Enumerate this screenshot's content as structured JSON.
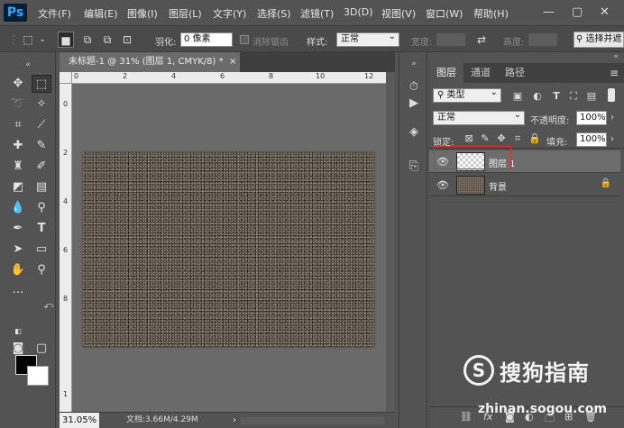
{
  "app": {
    "logo": "Ps"
  },
  "menu": [
    "文件(F)",
    "编辑(E)",
    "图像(I)",
    "图层(L)",
    "文字(Y)",
    "选择(S)",
    "滤镜(T)",
    "3D(D)",
    "视图(V)",
    "窗口(W)",
    "帮助(H)"
  ],
  "window_controls": [
    "—",
    "▢",
    "✕"
  ],
  "options": {
    "feather_label": "羽化:",
    "feather_value": "0 像素",
    "antialias_label": "消除锯齿",
    "style_label": "样式:",
    "style_value": "正常",
    "width_label": "宽度:",
    "height_label": "高度:",
    "select_mask_label": "选择并遮"
  },
  "document": {
    "tab_title": "未标题-1 @ 31% (图层 1, CMYK/8) *",
    "tab_close": "×",
    "hruler_labels": [
      "0",
      "2",
      "4",
      "6",
      "8",
      "10",
      "12"
    ],
    "vruler_labels": [
      "0",
      "2",
      "4",
      "6",
      "8",
      "1"
    ]
  },
  "status": {
    "zoom": "31.05%",
    "doc_info": "文档:3.66M/4.29M",
    "arrow": "›"
  },
  "layers_panel": {
    "tabs": [
      "图层",
      "通道",
      "路径"
    ],
    "active_tab": "图层",
    "filter_kind": "类型",
    "blend_mode": "正常",
    "opacity_label": "不透明度:",
    "opacity_value": "100%",
    "lock_label": "锁定:",
    "fill_label": "填充:",
    "fill_value": "100%",
    "layers": [
      {
        "name": "图层 1",
        "selected": true,
        "visible": true,
        "locked": false
      },
      {
        "name": "背景",
        "selected": false,
        "visible": true,
        "locked": true
      }
    ]
  },
  "colors": {
    "foreground": "#000000",
    "background": "#ffffff",
    "highlight": "#e02b2b",
    "ps_brand": "#31a8ff"
  },
  "watermark": {
    "logo_letter": "S",
    "text": "搜狗指南",
    "url": "zhinan.sogou.com"
  }
}
